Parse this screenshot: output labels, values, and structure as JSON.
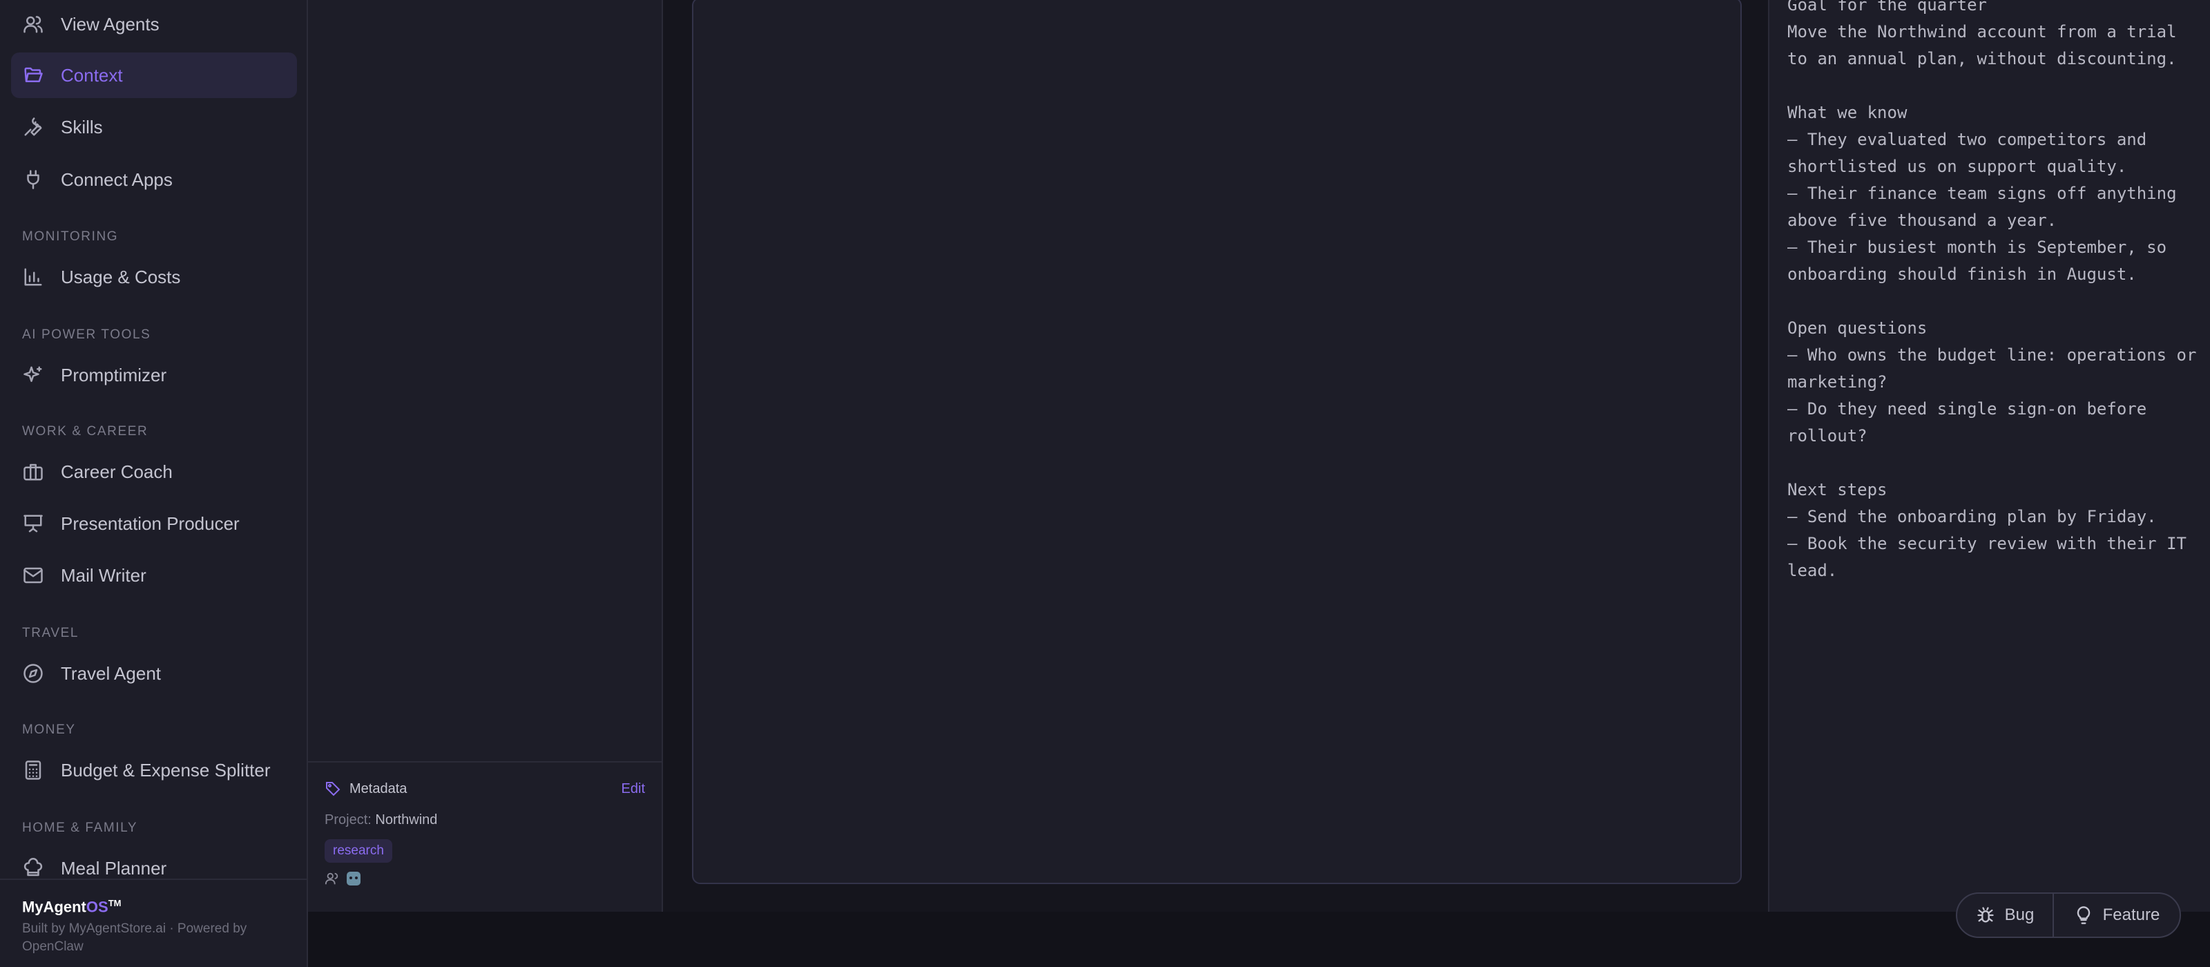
{
  "sidebar": {
    "items": [
      {
        "label": "View Agents",
        "icon": "users-icon"
      },
      {
        "label": "Context",
        "icon": "folder-open-icon",
        "active": true
      },
      {
        "label": "Skills",
        "icon": "wrench-icon"
      },
      {
        "label": "Connect Apps",
        "icon": "plug-icon"
      },
      {
        "label": "Usage & Costs",
        "icon": "bar-chart-icon"
      },
      {
        "label": "Promptimizer",
        "icon": "sparkles-icon"
      },
      {
        "label": "Career Coach",
        "icon": "briefcase-icon"
      },
      {
        "label": "Presentation Producer",
        "icon": "presentation-icon"
      },
      {
        "label": "Mail Writer",
        "icon": "mail-icon"
      },
      {
        "label": "Travel Agent",
        "icon": "compass-icon"
      },
      {
        "label": "Budget & Expense Splitter",
        "icon": "calculator-icon"
      },
      {
        "label": "Meal Planner",
        "icon": "chef-hat-icon"
      }
    ],
    "sections": {
      "monitoring": "Monitoring",
      "ai_power_tools": "AI Power Tools",
      "work_career": "Work & Career",
      "travel": "Travel",
      "money": "Money",
      "home_family": "Home & Family"
    },
    "footer": {
      "brand_main": "MyAgent",
      "brand_accent": "OS",
      "brand_tm": "TM",
      "credits": "Built by MyAgentStore.ai · Powered by OpenClaw"
    }
  },
  "metadata": {
    "title": "Metadata",
    "edit_label": "Edit",
    "project_label": "Project:",
    "project_value": "Northwind",
    "tag": "research"
  },
  "preview": {
    "text": "Goal for the quarter\nMove the Northwind account from a trial to an annual plan, without discounting.\n\nWhat we know\n– They evaluated two competitors and shortlisted us on support quality.\n– Their finance team signs off anything above five thousand a year.\n– Their busiest month is September, so onboarding should finish in August.\n\nOpen questions\n– Who owns the budget line: operations or marketing?\n– Do they need single sign-on before rollout?\n\nNext steps\n– Send the onboarding plan by Friday.\n– Book the security review with their IT lead."
  },
  "feedback": {
    "bug_label": "Bug",
    "feature_label": "Feature"
  },
  "colors": {
    "accent": "#8b6cf0",
    "background": "#1d1d28"
  }
}
